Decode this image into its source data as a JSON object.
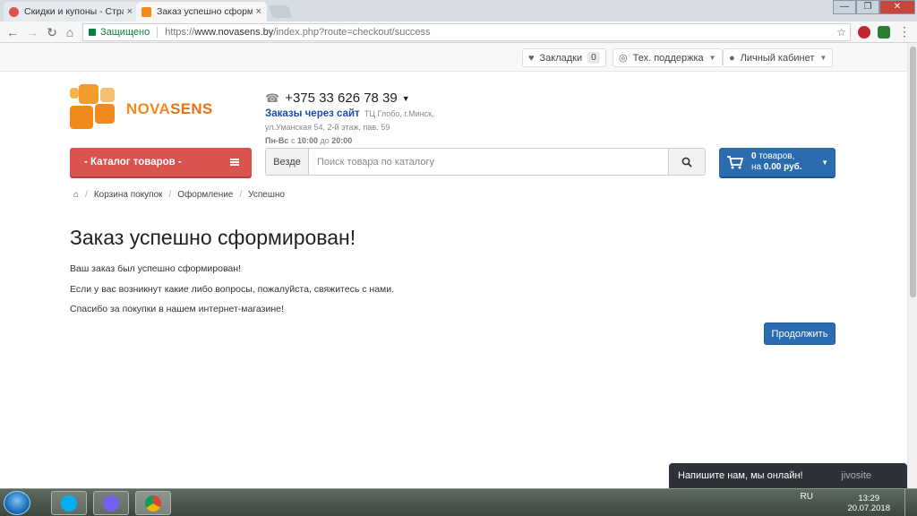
{
  "browser": {
    "tabs": [
      {
        "title": "Скидки и купоны - Стра",
        "active": false,
        "favicon_color": "#d9534f"
      },
      {
        "title": "Заказ успешно сформир",
        "active": true,
        "favicon_color": "#f18a1c"
      }
    ],
    "tab_close": "×",
    "window_controls": {
      "minimize": "—",
      "maximize": "❐",
      "close": "✕"
    },
    "secure_label": "Защищено",
    "url_scheme": "https://",
    "url_host": "www.novasens.by",
    "url_path": "/index.php?route=checkout/success",
    "nav": {
      "back": "←",
      "forward": "→",
      "reload": "↻",
      "home": "⌂"
    }
  },
  "header": {
    "bookmarks_label": "Закладки",
    "bookmarks_count": "0",
    "support_label": "Тех. поддержка",
    "account_label": "Личный кабинет"
  },
  "logo": {
    "part1": "NOVA",
    "part2": "SENS",
    "colors": [
      "#f39c2e",
      "#f18a1c",
      "#f7b24d",
      "#f18a1c",
      "#f8c170"
    ]
  },
  "contacts": {
    "phone": "+375 33 626 78 39",
    "orders_label": "Заказы через сайт",
    "address_1": "ТЦ Глобо, г.Минск,",
    "address_2": "ул.Уманская 54, 2-й этаж, пав. 59",
    "hours_days": "Пн-Вс",
    "hours_from_label": "с",
    "hours_from": "10:00",
    "hours_to_label": "до",
    "hours_to": "20:00"
  },
  "catalog_button": "- Каталог товаров -",
  "search": {
    "scope": "Везде",
    "placeholder": "Поиск товара по каталогу"
  },
  "cart": {
    "count_text": "0",
    "count_suffix": "товаров,",
    "sum_prefix": "на",
    "sum": "0.00 руб."
  },
  "breadcrumb": [
    "Корзина покупок",
    "Оформление",
    "Успешно"
  ],
  "main": {
    "title": "Заказ успешно сформирован!",
    "paragraphs": [
      "Ваш заказ был успешно сформирован!",
      "Если у вас возникнут какие либо вопросы, пожалуйста, свяжитесь с нами.",
      "Спасибо за покупки в нашем интернет-магазине!"
    ],
    "continue_label": "Продолжить"
  },
  "chat": {
    "text": "Напишите нам, мы онлайн!",
    "brand": "jivosite"
  },
  "taskbar": {
    "language": "RU",
    "time": "13:29",
    "date": "20.07.2018"
  },
  "colors": {
    "accent_red": "#d9534f",
    "accent_blue": "#2b6cb0",
    "brand_orange": "#f18a1c",
    "link_blue": "#1c4ea5"
  }
}
